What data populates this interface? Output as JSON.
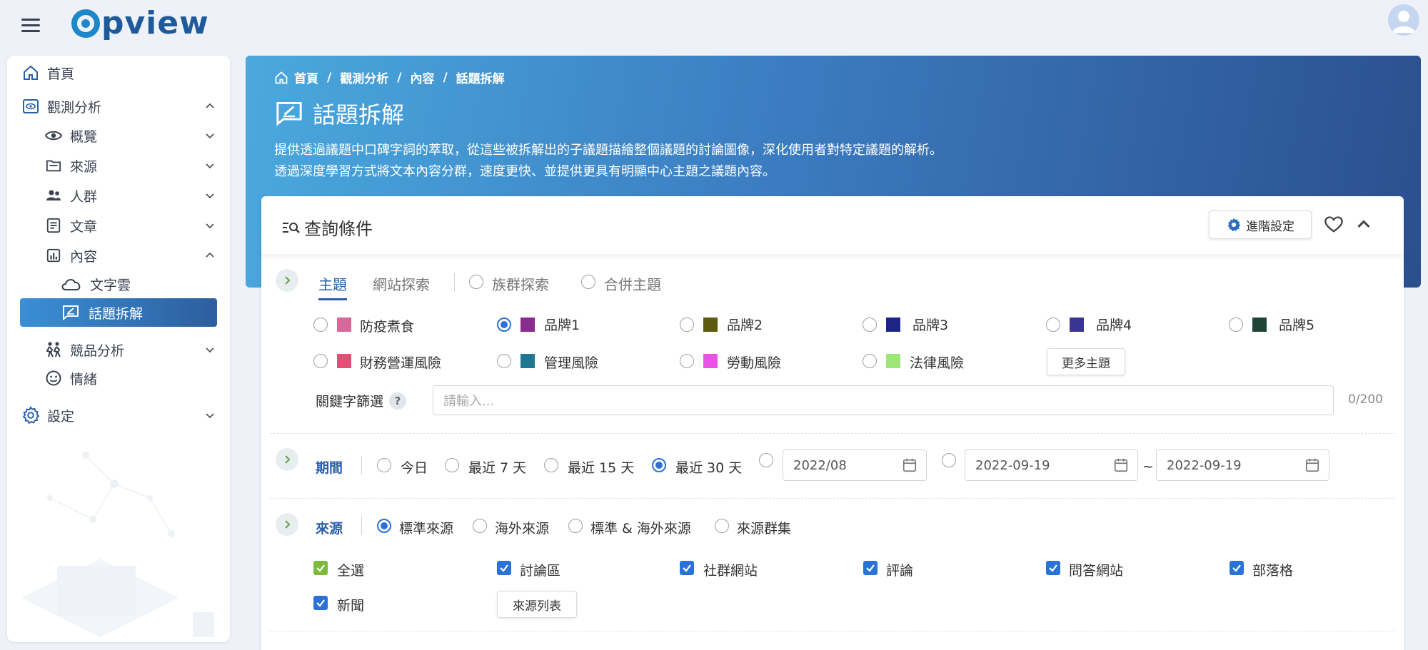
{
  "app": {
    "logo_text": "pview"
  },
  "sidebar": {
    "home": "首頁",
    "observe": "觀測分析",
    "overview": "概覽",
    "source": "來源",
    "people": "人群",
    "article": "文章",
    "content": "內容",
    "wordcloud": "文字雲",
    "topic_split": "話題拆解",
    "competitor": "競品分析",
    "emotion": "情緒",
    "settings": "設定"
  },
  "breadcrumb": {
    "home": "首頁",
    "sep": "/",
    "l1": "觀測分析",
    "l2": "內容",
    "l3": "話題拆解"
  },
  "page": {
    "title": "話題拆解",
    "desc1": "提供透過議題中口碑字詞的萃取，從這些被拆解出的子議題描繪整個議題的討論圖像，深化使用者對特定議題的解析。",
    "desc2": "透過深度學習方式將文本內容分群，速度更快、並提供更具有明顯中心主題之議題內容。"
  },
  "query": {
    "title": "查詢條件",
    "advanced": "進階設定",
    "tabs": {
      "topic": "主題",
      "site": "網站探索",
      "group": "族群探索",
      "merge": "合併主題"
    },
    "topics": [
      {
        "label": "防疫煮食",
        "color": "#d9679a"
      },
      {
        "label": "品牌1",
        "color": "#8b2a8f"
      },
      {
        "label": "品牌2",
        "color": "#5e5a0e"
      },
      {
        "label": "品牌3",
        "color": "#1c2485"
      },
      {
        "label": "品牌4",
        "color": "#3a3590"
      },
      {
        "label": "品牌5",
        "color": "#1f4536"
      },
      {
        "label": "財務營運風險",
        "color": "#e24f74"
      },
      {
        "label": "管理風險",
        "color": "#1b7792"
      },
      {
        "label": "勞動風險",
        "color": "#e952e5"
      },
      {
        "label": "法律風險",
        "color": "#9ce675"
      }
    ],
    "more_topics": "更多主題",
    "keyword_label": "關鍵字篩選",
    "help": "?",
    "keyword_placeholder": "請輸入...",
    "keyword_count": "0/200",
    "period": {
      "label": "期間",
      "today": "今日",
      "d7": "最近 7 天",
      "d15": "最近 15 天",
      "d30": "最近 30 天",
      "month_value": "2022/08",
      "date_from": "2022-09-19",
      "tilde": "~",
      "date_to": "2022-09-19"
    },
    "source": {
      "label": "來源",
      "standard": "標準來源",
      "overseas": "海外來源",
      "both": "標準 & 海外來源",
      "cluster": "來源群集",
      "all": "全選",
      "forum": "討論區",
      "social": "社群網站",
      "review": "評論",
      "qa": "問答網站",
      "blog": "部落格",
      "news": "新聞",
      "list_btn": "來源列表"
    }
  }
}
